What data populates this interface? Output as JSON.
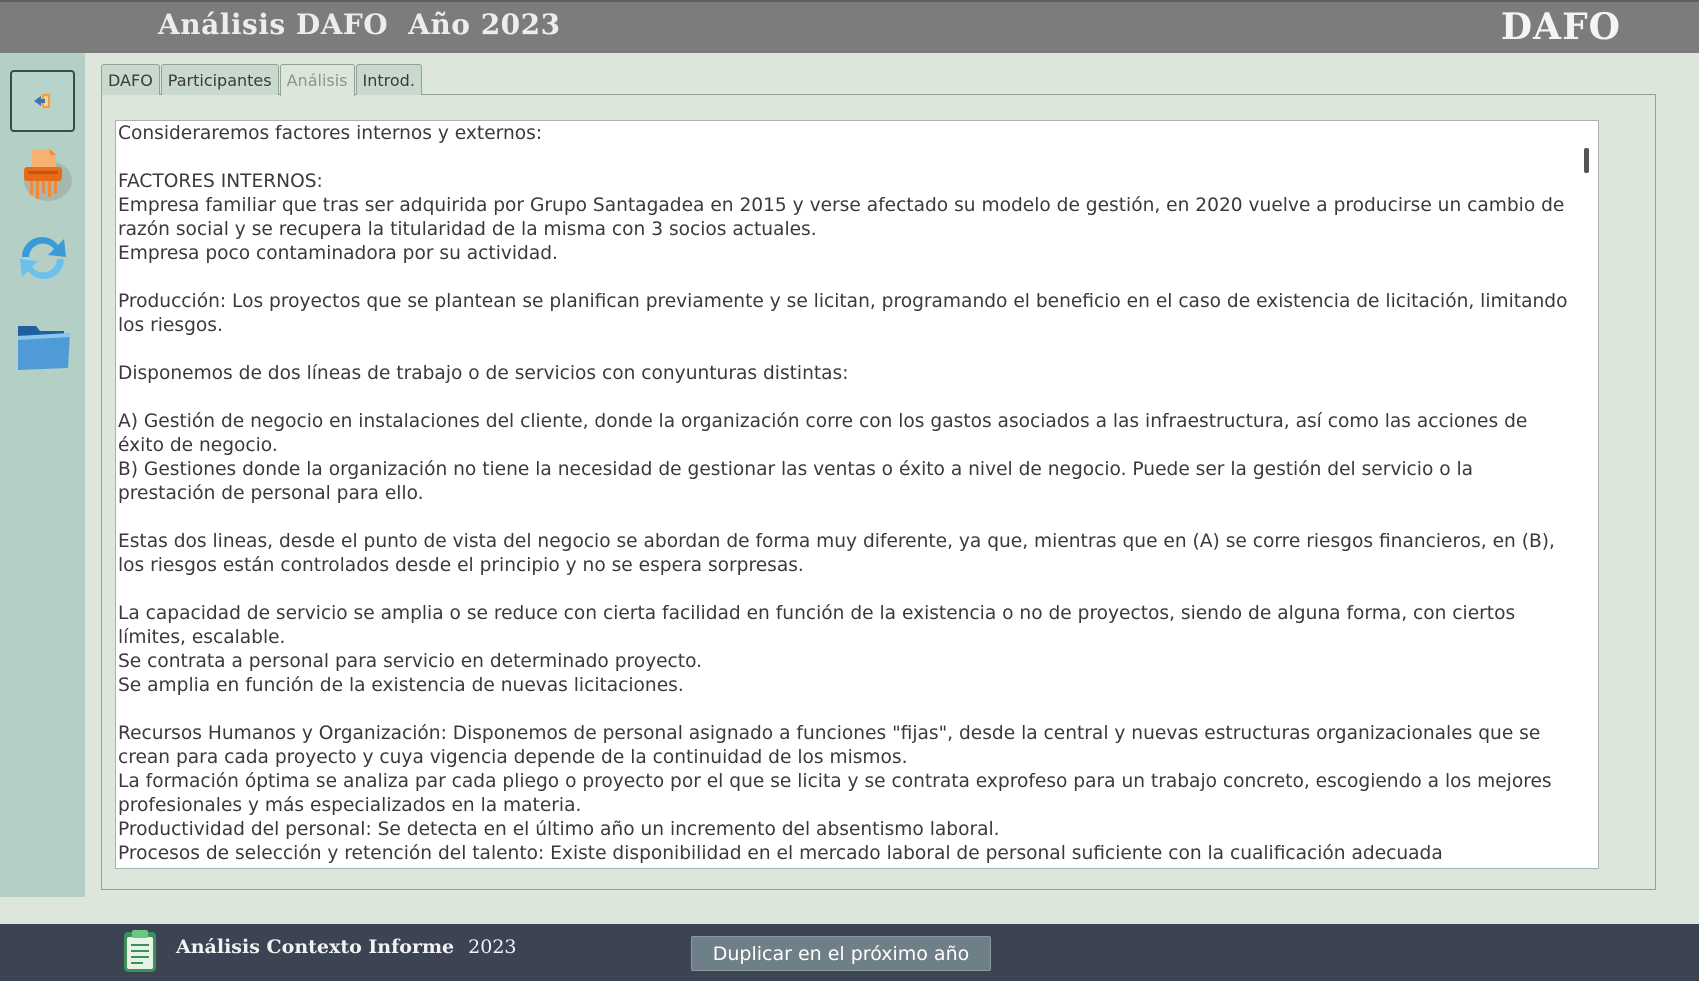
{
  "header": {
    "title": "Análisis DAFO",
    "year_label": "Año 2023",
    "brand": "DAFO"
  },
  "tabs": [
    {
      "label": "DAFO",
      "active": false
    },
    {
      "label": "Participantes",
      "active": false
    },
    {
      "label": "Análisis",
      "active": true
    },
    {
      "label": "Introd.",
      "active": false
    }
  ],
  "sidebar": {
    "icons": [
      "exit-icon",
      "shredder-icon",
      "refresh-icon",
      "folder-icon"
    ]
  },
  "analysis_text": "Consideraremos factores internos y externos:\n\nFACTORES INTERNOS:\nEmpresa familiar que tras ser adquirida por Grupo Santagadea en 2015 y verse afectado su modelo de gestión, en 2020 vuelve a producirse un cambio de razón social y se recupera la titularidad de la misma con 3 socios actuales.\nEmpresa poco contaminadora por su actividad.\n\nProducción: Los proyectos que se plantean se planifican previamente y se licitan, programando el beneficio en el caso de existencia de licitación, limitando los riesgos.\n\nDisponemos de dos líneas de trabajo o de servicios con conyunturas distintas:\n\nA) Gestión de negocio en instalaciones del cliente, donde la organización corre con los gastos asociados a las infraestructura, así como las acciones de éxito de negocio.\nB) Gestiones donde la organización no tiene la necesidad de gestionar las ventas o éxito a nivel de negocio. Puede ser la gestión del servicio o la prestación de personal para ello.\n\nEstas dos lineas, desde el punto de vista del negocio se abordan de forma muy diferente, ya que, mientras que en (A) se corre riesgos financieros, en (B), los riesgos están controlados desde el principio y no se espera sorpresas.\n\nLa capacidad de servicio se amplia o se reduce con cierta facilidad en función de la existencia o no de proyectos, siendo de alguna forma, con ciertos límites, escalable.\nSe contrata a personal para servicio en determinado proyecto.\nSe amplia en función de la existencia de nuevas licitaciones.\n\nRecursos Humanos y Organización: Disponemos de personal asignado a funciones \"fijas\", desde la central y nuevas estructuras organizacionales que se crean para cada proyecto y cuya vigencia depende de la continuidad de los mismos.\nLa formación óptima se analiza par cada pliego o proyecto por el que se licita y se contrata exprofeso para un trabajo concreto, escogiendo a los mejores profesionales y más especializados en la materia.\nProductividad del personal: Se detecta en el último año un incremento del absentismo laboral.\nProcesos de selección y retención del talento: Existe disponibilidad en el mercado laboral de personal suficiente con la cualificación adecuada",
  "footer": {
    "report_label": "Análisis Contexto Informe",
    "report_year": "2023",
    "duplicate_button": "Duplicar en el próximo año"
  }
}
